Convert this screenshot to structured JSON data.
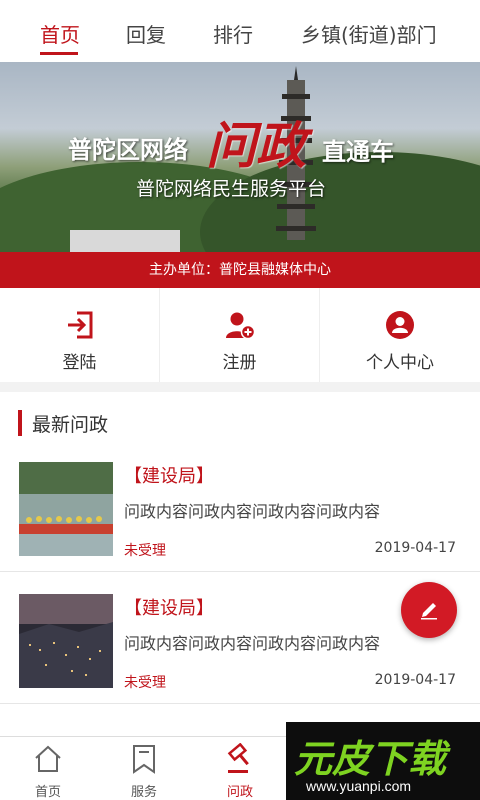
{
  "top_tabs": [
    {
      "label": "首页",
      "active": true
    },
    {
      "label": "回复",
      "active": false
    },
    {
      "label": "排行",
      "active": false
    },
    {
      "label": "乡镇(街道)部门",
      "active": false
    }
  ],
  "banner": {
    "title_part1": "普陀区网络",
    "title_emphasis": "问政",
    "title_part2": "直通车",
    "subtitle": "普陀网络民生服务平台",
    "sponsor": "主办单位：普陀县融媒体中心"
  },
  "actions": [
    {
      "label": "登陆",
      "icon": "login-icon"
    },
    {
      "label": "注册",
      "icon": "register-user-icon"
    },
    {
      "label": "个人中心",
      "icon": "user-center-icon"
    }
  ],
  "section": {
    "title": "最新问政"
  },
  "items": [
    {
      "category": "【建设局】",
      "content": "问政内容问政内容问政内容问政内容",
      "status": "未受理",
      "date": "2019-04-17",
      "thumb": "dragon-boat-photo"
    },
    {
      "category": "【建设局】",
      "content": "问政内容问政内容问政内容问政内容",
      "status": "未受理",
      "date": "2019-04-17",
      "thumb": "night-city-photo"
    }
  ],
  "bottom_nav": [
    {
      "label": "首页",
      "icon": "home-icon",
      "active": false
    },
    {
      "label": "服务",
      "icon": "bookmark-icon",
      "active": false
    },
    {
      "label": "问政",
      "icon": "gavel-icon",
      "active": true
    }
  ],
  "watermark": {
    "brand": "元皮下载",
    "url": "www.yuanpi.com"
  },
  "colors": {
    "accent": "#c0141b",
    "fab": "#d21a25"
  }
}
